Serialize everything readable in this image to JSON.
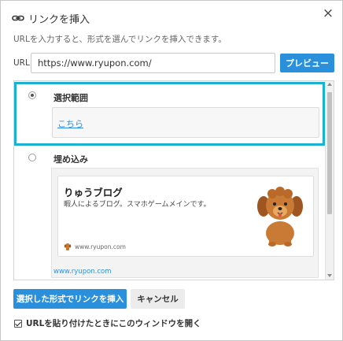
{
  "dialog": {
    "title": "リンクを挿入",
    "close_label": "×",
    "description": "URLを入力すると、形式を選んでリンクを挿入できます。"
  },
  "url": {
    "label": "URL",
    "value": "https://www.ryupon.com/"
  },
  "buttons": {
    "preview": "プレビュー",
    "insert": "選択した形式でリンクを挿入",
    "cancel": "キャンセル"
  },
  "options": {
    "selection": {
      "title": "選択範囲",
      "link_text": "こちら",
      "checked": true
    },
    "embed": {
      "title": "埋め込み",
      "checked": false,
      "card": {
        "title": "りゅうブログ",
        "description": "暇人によるブログ。スマホゲームメインです。",
        "site": "www.ryupon.com"
      },
      "link": "www.ryupon.com"
    }
  },
  "footer": {
    "checkbox_label": "URLを貼り付けたときにこのウィンドウを開く",
    "checkbox_checked": true
  },
  "icons": {
    "title_icon": "link-icon",
    "close": "close-icon",
    "card_site_icon": "dog-favicon-icon",
    "card_image": "dog-illustration"
  },
  "colors": {
    "accent": "#2b90dc",
    "selected_border": "#1cb1d3"
  }
}
